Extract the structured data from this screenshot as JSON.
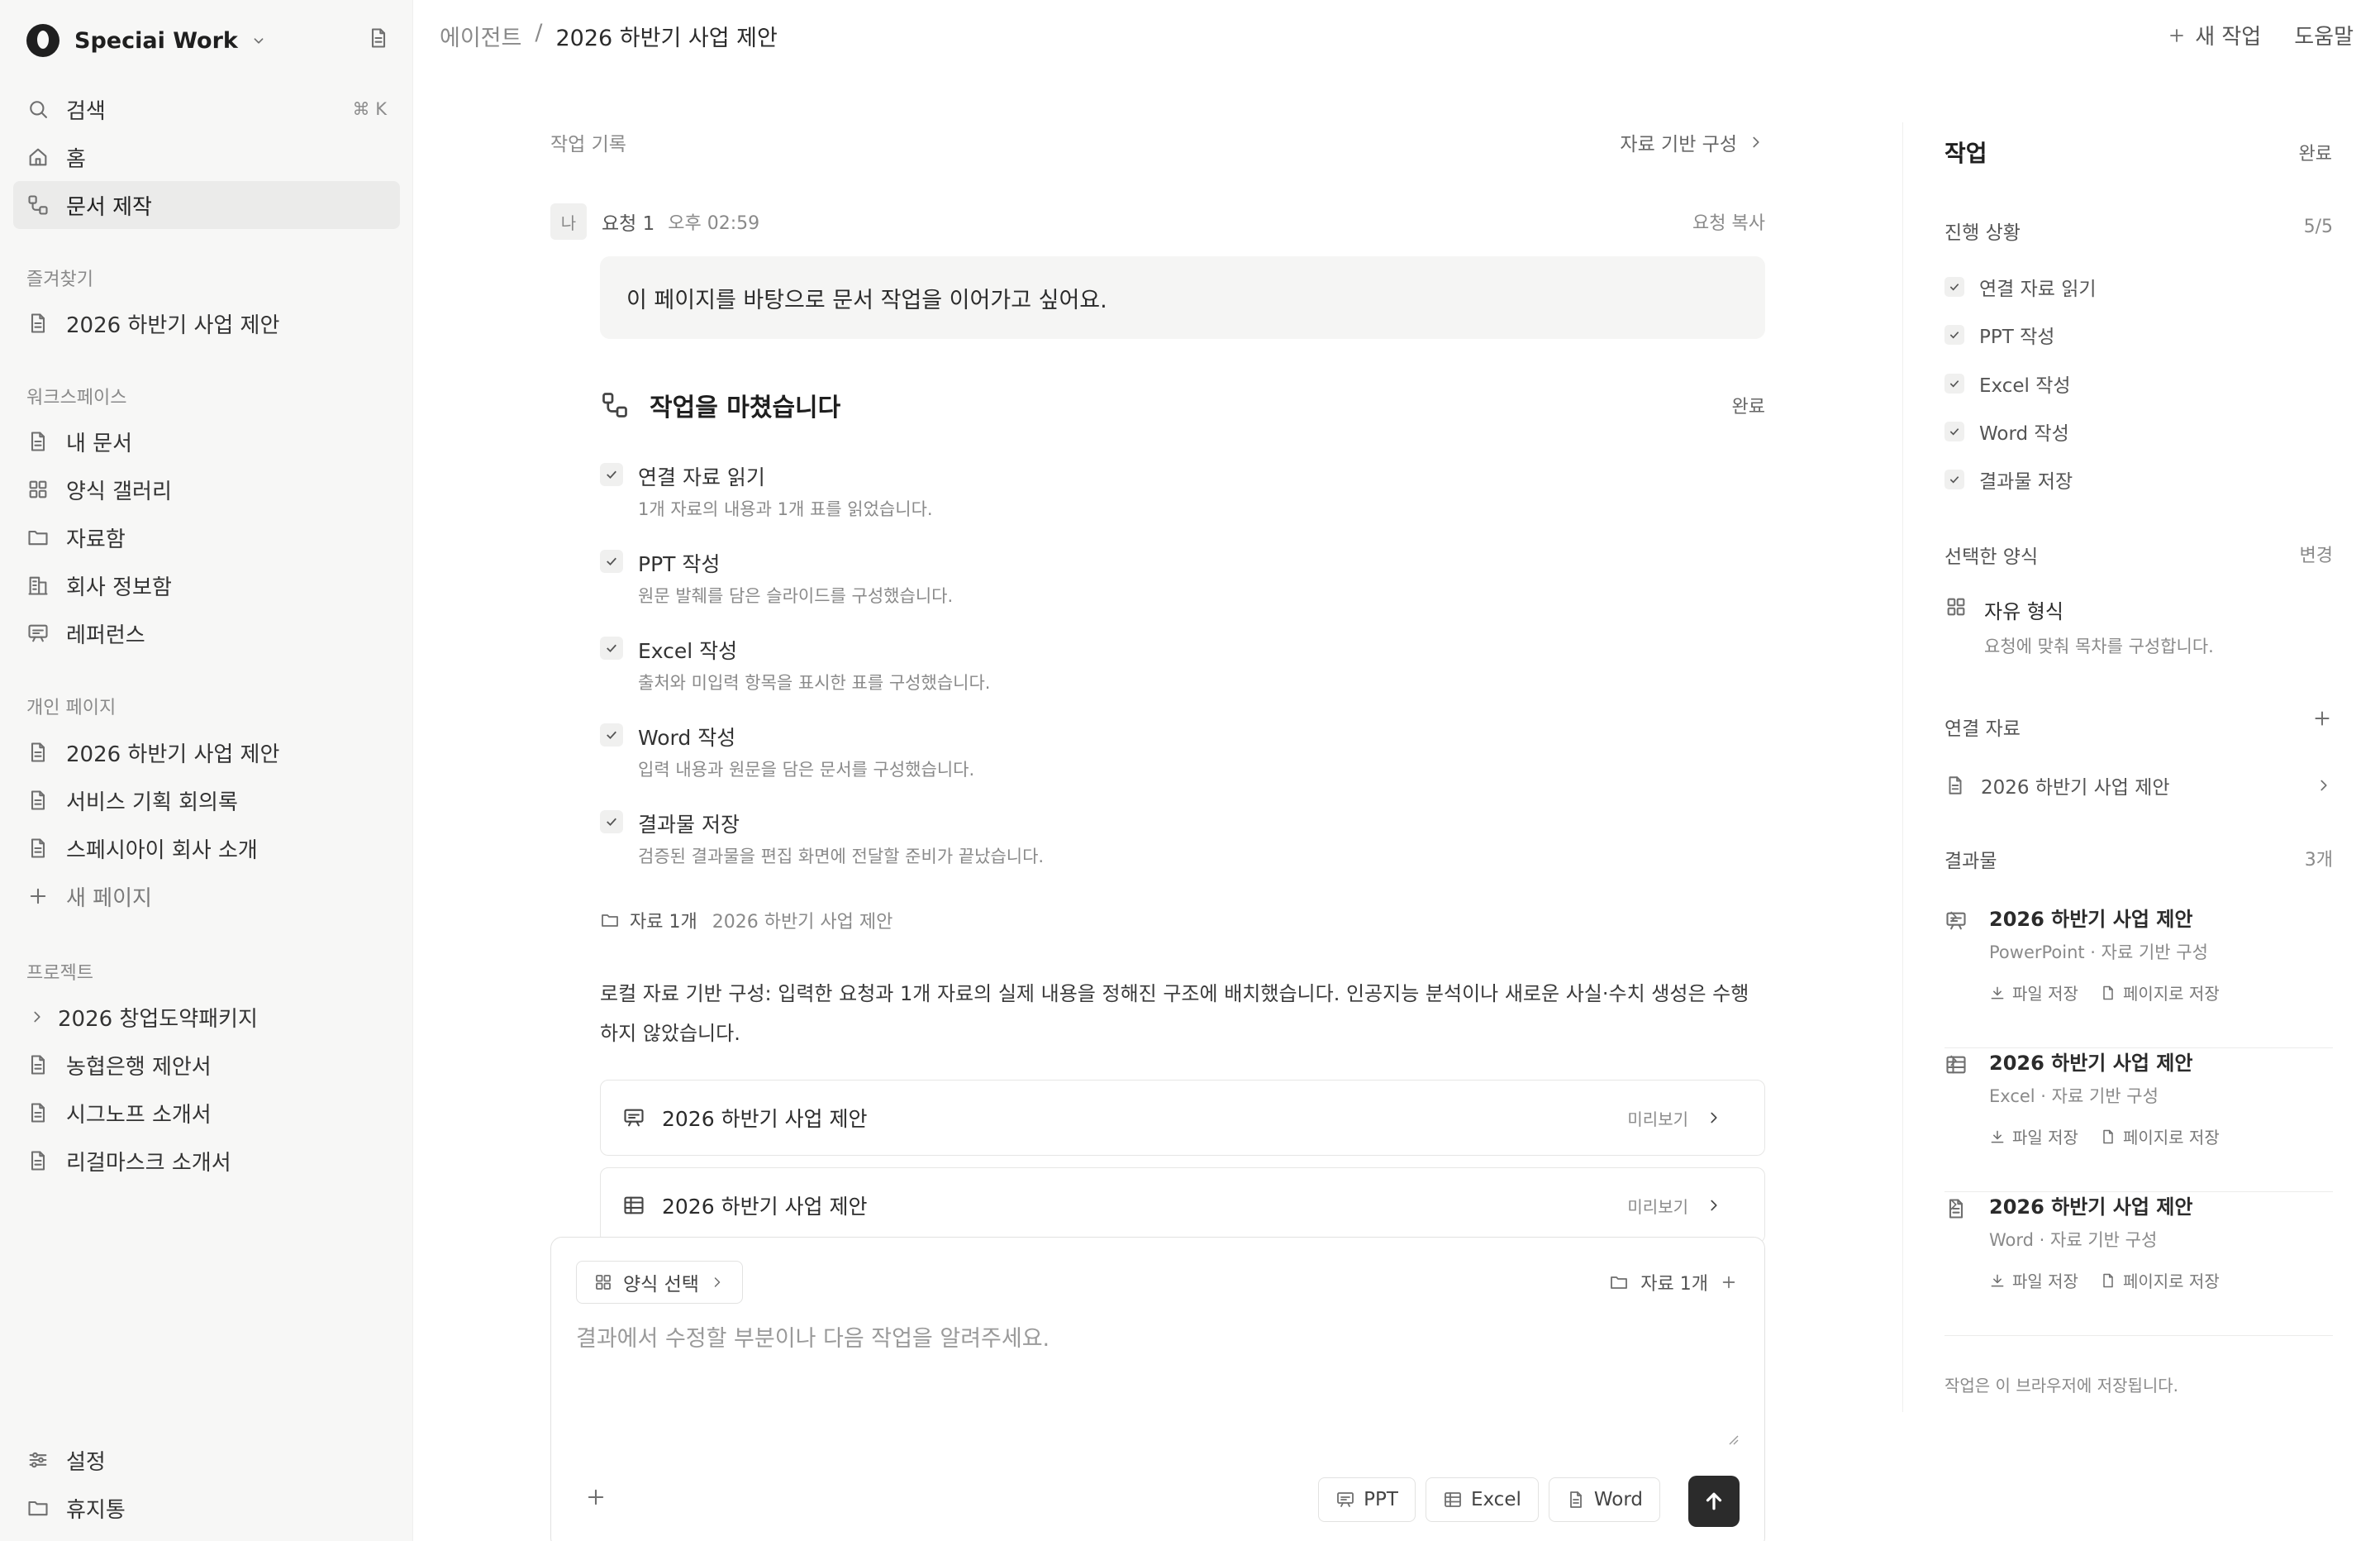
{
  "sidebar": {
    "workspace_name": "Speciai Work",
    "search_label": "검색",
    "search_shortcut": "⌘ K",
    "home_label": "홈",
    "doc_make_label": "문서 제작",
    "favorites_label": "즐겨찾기",
    "favorites": [
      "2026 하반기 사업 제안"
    ],
    "workspace_label": "워크스페이스",
    "workspace_items": [
      "내 문서",
      "양식 갤러리",
      "자료함",
      "회사 정보함",
      "레퍼런스"
    ],
    "personal_label": "개인 페이지",
    "personal_items": [
      "2026 하반기 사업 제안",
      "서비스 기획 회의록",
      "스페시아이 회사 소개"
    ],
    "new_page_label": "새 페이지",
    "projects_label": "프로젝트",
    "projects": [
      "2026 창업도약패키지",
      "농협은행 제안서",
      "시그노프 소개서",
      "리걸마스크 소개서"
    ],
    "settings_label": "설정",
    "trash_label": "휴지통"
  },
  "topbar": {
    "crumb_root": "에이전트",
    "crumb_sep": "/",
    "crumb_current": "2026 하반기 사업 제안",
    "new_task_label": "새 작업",
    "help_label": "도움말"
  },
  "main": {
    "worklog_label": "작업 기록",
    "worklog_right": "자료 기반 구성",
    "avatar": "나",
    "request_name": "요청 1",
    "request_time": "오후 02:59",
    "request_copy": "요청 복사",
    "request_text": "이 페이지를 바탕으로 문서 작업을 이어가고 싶어요.",
    "done_title": "작업을 마쳤습니다",
    "done_badge": "완료",
    "steps": [
      {
        "title": "연결 자료 읽기",
        "desc": "1개 자료의 내용과 1개 표를 읽었습니다."
      },
      {
        "title": "PPT 작성",
        "desc": "원문 발췌를 담은 슬라이드를 구성했습니다."
      },
      {
        "title": "Excel 작성",
        "desc": "출처와 미입력 항목을 표시한 표를 구성했습니다."
      },
      {
        "title": "Word 작성",
        "desc": "입력 내용과 원문을 담은 문서를 구성했습니다."
      },
      {
        "title": "결과물 저장",
        "desc": "검증된 결과물을 편집 화면에 전달할 준비가 끝났습니다."
      }
    ],
    "source_count": "자료 1개",
    "source_name": "2026 하반기 사업 제안",
    "summary": "로컬 자료 기반 구성: 입력한 요청과 1개 자료의 실제 내용을 정해진 구조에 배치했습니다. 인공지능 분석이나 새로운 사실·수치 생성은 수행하지 않았습니다.",
    "outputs": [
      {
        "name": "2026 하반기 사업 제안",
        "preview": "미리보기",
        "icon": "presentation-icon"
      },
      {
        "name": "2026 하반기 사업 제안",
        "preview": "미리보기",
        "icon": "table-icon"
      }
    ]
  },
  "composer": {
    "template_button": "양식 선택",
    "materials": "자료 1개",
    "placeholder": "결과에서 수정할 부분이나 다음 작업을 알려주세요.",
    "formats": [
      "PPT",
      "Excel",
      "Word"
    ]
  },
  "panel": {
    "title": "작업",
    "status": "완료",
    "progress_label": "진행 상황",
    "progress_count": "5/5",
    "progress_items": [
      "연결 자료 읽기",
      "PPT 작성",
      "Excel 작성",
      "Word 작성",
      "결과물 저장"
    ],
    "template_label": "선택한 양식",
    "template_change": "변경",
    "template_name": "자유 형식",
    "template_desc": "요청에 맞춰 목차를 구성합니다.",
    "materials_label": "연결 자료",
    "material_name": "2026 하반기 사업 제안",
    "outputs_label": "결과물",
    "outputs_count": "3개",
    "outputs": [
      {
        "name": "2026 하반기 사업 제안",
        "desc": "PowerPoint · 자료 기반 구성",
        "icon": "presentation-icon"
      },
      {
        "name": "2026 하반기 사업 제안",
        "desc": "Excel · 자료 기반 구성",
        "icon": "table-icon"
      },
      {
        "name": "2026 하반기 사업 제안",
        "desc": "Word · 자료 기반 구성",
        "icon": "document-icon"
      }
    ],
    "save_file": "파일 저장",
    "save_page": "페이지로 저장",
    "footer": "작업은 이 브라우저에 저장됩니다."
  }
}
